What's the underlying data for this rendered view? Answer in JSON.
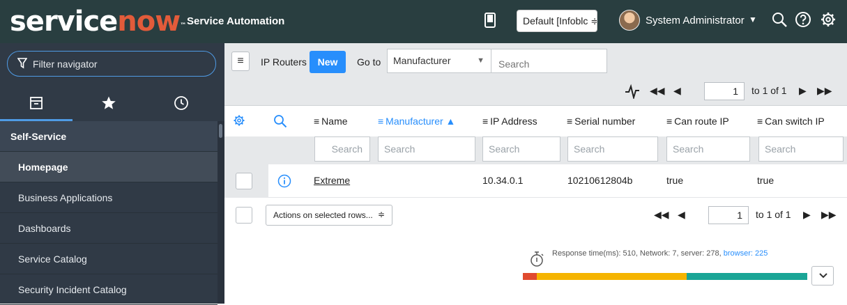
{
  "topbar": {
    "logo_service": "service",
    "logo_now": "now",
    "logo_tm": "™",
    "app_name": "Service Automation",
    "domain_select": "Default [Infoblc ≑",
    "user_name": "System Administrator",
    "icons": [
      "document-icon",
      "search-icon",
      "help-icon",
      "gear-icon"
    ],
    "logo_accent_color": "#e25b3a",
    "bar_color": "#293e40"
  },
  "navigator": {
    "filter_placeholder": "Filter navigator",
    "tabs": [
      "archive-icon",
      "star-icon",
      "clock-icon"
    ],
    "items": [
      {
        "label": "Self-Service",
        "kind": "header"
      },
      {
        "label": "Homepage",
        "kind": "selected"
      },
      {
        "label": "Business Applications",
        "kind": "sub"
      },
      {
        "label": "Dashboards",
        "kind": "sub"
      },
      {
        "label": "Service Catalog",
        "kind": "sub"
      },
      {
        "label": "Security Incident Catalog",
        "kind": "sub"
      }
    ]
  },
  "list": {
    "title": "IP Routers",
    "new_label": "New",
    "goto_label": "Go to",
    "goto_field": "Manufacturer",
    "search_placeholder": "Search",
    "accent_color": "#278efc"
  },
  "pagination": {
    "page": "1",
    "count_text": "to 1 of 1"
  },
  "columns": [
    {
      "label": "Name",
      "sorted": false
    },
    {
      "label": "Manufacturer ▲",
      "sorted": true
    },
    {
      "label": "IP Address",
      "sorted": false
    },
    {
      "label": "Serial number",
      "sorted": false
    },
    {
      "label": "Can route IP",
      "sorted": false
    },
    {
      "label": "Can switch IP",
      "sorted": false
    }
  ],
  "column_search_placeholder": "Search",
  "rows": [
    {
      "name": "Extreme",
      "manufacturer": "",
      "ip_address": "10.34.0.1",
      "serial_number": "10210612804b",
      "can_route_ip": "true",
      "can_switch_ip": "true"
    }
  ],
  "actions": {
    "select_label": "Actions on selected rows..."
  },
  "response": {
    "text": "Response time(ms): 510, Network: 7, server: 278,",
    "browser_text": "browser: 225",
    "timings": {
      "network": 7,
      "server": 278,
      "browser": 225
    },
    "colors": {
      "network": "#e04a2f",
      "server": "#f5b400",
      "browser": "#1aa596"
    }
  }
}
